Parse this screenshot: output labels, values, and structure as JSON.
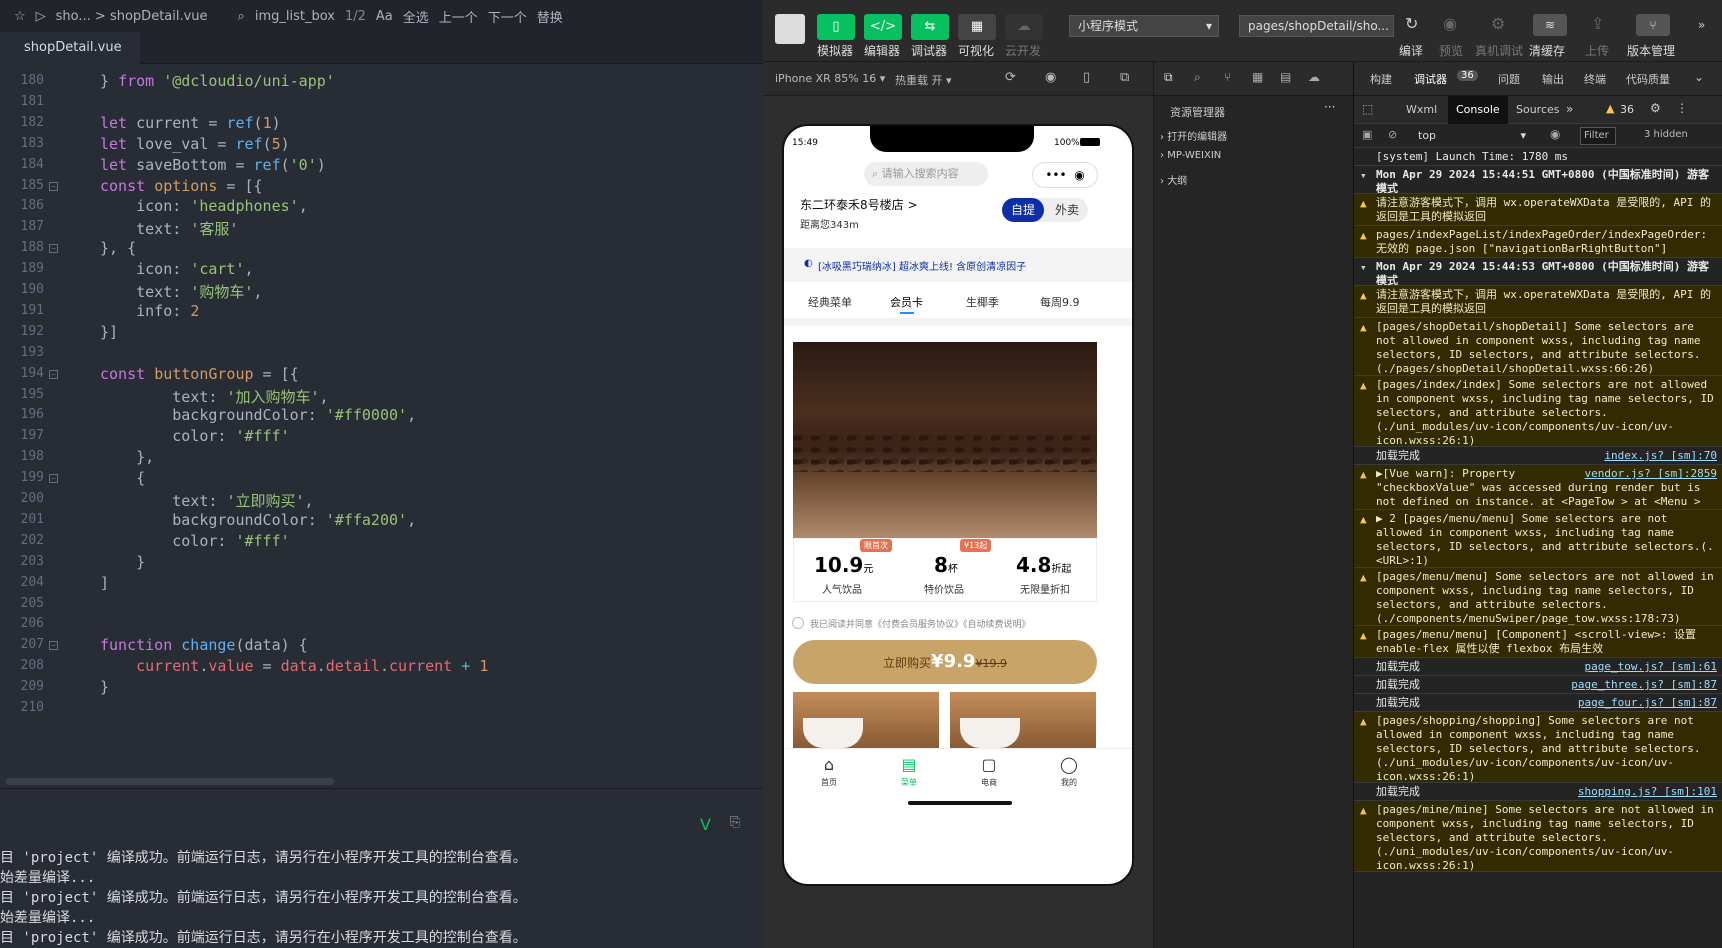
{
  "editor": {
    "top_items": [
      "sho...",
      "shopDetail.vue",
      "img_list_box",
      "1/2",
      "Aa",
      "全选",
      "上一个",
      "下一个",
      "替换"
    ],
    "tab": "shopDetail.vue",
    "lines": [
      {
        "n": "180",
        "html": "} <span class=\"kw\">from</span> <span class=\"str\">'@dcloudio/uni-app'</span>"
      },
      {
        "n": "181",
        "html": ""
      },
      {
        "n": "182",
        "html": "<span class=\"kw\">let</span> current = <span class=\"fn\">ref</span>(<span class=\"num\">1</span>)"
      },
      {
        "n": "183",
        "html": "<span class=\"kw\">let</span> love_val = <span class=\"fn\">ref</span>(<span class=\"num\">5</span>)"
      },
      {
        "n": "184",
        "html": "<span class=\"kw\">let</span> saveBottom = <span class=\"fn\">ref</span>(<span class=\"str\">'0'</span>)"
      },
      {
        "n": "185",
        "html": "<span class=\"kw\">const</span> <span class=\"num\">options</span> = [{",
        "fold": true
      },
      {
        "n": "186",
        "html": "    icon: <span class=\"str\">'headphones'</span>,"
      },
      {
        "n": "187",
        "html": "    text: <span class=\"str\">'客服'</span>"
      },
      {
        "n": "188",
        "html": "}, {",
        "fold": true
      },
      {
        "n": "189",
        "html": "    icon: <span class=\"str\">'cart'</span>,"
      },
      {
        "n": "190",
        "html": "    text: <span class=\"str\">'购物车'</span>,"
      },
      {
        "n": "191",
        "html": "    info: <span class=\"num\">2</span>"
      },
      {
        "n": "192",
        "html": "}]"
      },
      {
        "n": "193",
        "html": ""
      },
      {
        "n": "194",
        "html": "<span class=\"kw\">const</span> <span class=\"num\">buttonGroup</span> = [{",
        "fold": true
      },
      {
        "n": "195",
        "html": "        text: <span class=\"str\">'加入购物车'</span>,"
      },
      {
        "n": "196",
        "html": "        backgroundColor: <span class=\"str\">'#ff0000'</span>,"
      },
      {
        "n": "197",
        "html": "        color: <span class=\"str\">'#fff'</span>"
      },
      {
        "n": "198",
        "html": "    },"
      },
      {
        "n": "199",
        "html": "    {",
        "fold": true
      },
      {
        "n": "200",
        "html": "        text: <span class=\"str\">'立即购买'</span>,"
      },
      {
        "n": "201",
        "html": "        backgroundColor: <span class=\"str\">'#ffa200'</span>,"
      },
      {
        "n": "202",
        "html": "        color: <span class=\"str\">'#fff'</span>"
      },
      {
        "n": "203",
        "html": "    }"
      },
      {
        "n": "204",
        "html": "]"
      },
      {
        "n": "205",
        "html": ""
      },
      {
        "n": "206",
        "html": ""
      },
      {
        "n": "207",
        "html": "<span class=\"kw\">function</span> <span class=\"fn\">change</span>(data) {",
        "fold": true
      },
      {
        "n": "208",
        "html": "    <span class=\"var\">current</span>.<span class=\"var\">value</span> = <span class=\"var\">data</span>.<span class=\"var\">detail</span>.<span class=\"var\">current</span> <span class=\"op\">+</span> <span class=\"num\">1</span>"
      },
      {
        "n": "209",
        "html": "}"
      },
      {
        "n": "210",
        "html": ""
      }
    ],
    "console_lines": [
      "目 'project' 编译成功。前端运行日志，请另行在小程序开发工具的控制台查看。",
      "始差量编译...",
      "目 'project' 编译成功。前端运行日志，请另行在小程序开发工具的控制台查看。",
      "始差量编译...",
      "目 'project' 编译成功。前端运行日志，请另行在小程序开发工具的控制台查看。"
    ]
  },
  "toolbar": {
    "buttons": [
      "模拟器",
      "编辑器",
      "调试器",
      "可视化",
      "云开发"
    ],
    "mode_select": "小程序模式",
    "path_select": "pages/shopDetail/sho...",
    "right_buttons": [
      "编译",
      "预览",
      "真机调试",
      "清缓存",
      "上传",
      "版本管理"
    ]
  },
  "sim": {
    "device": "iPhone XR 85% 16",
    "hotreload": "热重载 开"
  },
  "phone": {
    "time": "15:49",
    "battery": "100%",
    "search_placeholder": "请输入搜索内容",
    "address": "东二环泰禾8号楼店 >",
    "distance": "距离您343m",
    "mode_self": "自提",
    "mode_takeout": "外卖",
    "notice": "[冰吸黑巧瑞纳冰] 超冰爽上线! 含原创清凉因子",
    "tabs": [
      "经典菜单",
      "会员卡",
      "生椰季",
      "每周9.9"
    ],
    "stats": [
      {
        "big": "10.9",
        "unit": "元",
        "label": "人气饮品",
        "badge": "限首次"
      },
      {
        "big": "8",
        "unit": "杯",
        "label": "特价饮品",
        "badge": "¥13起"
      },
      {
        "big": "4.8",
        "unit": "折起",
        "label": "无限量折扣",
        "badge": ""
      }
    ],
    "agree": "我已阅读并同意《付费会员服务协议》《自动续费说明》",
    "buy_label": "立即购买",
    "buy_price": "¥9.9",
    "buy_old": "¥19.9",
    "nav": [
      "首页",
      "菜单",
      "电商",
      "我的"
    ]
  },
  "explorer": {
    "title": "资源管理器",
    "items": [
      "打开的编辑器",
      "MP-WEIXIN",
      "大纲"
    ]
  },
  "devtools": {
    "top_tabs": [
      "构建",
      "调试器",
      "问题",
      "输出",
      "终端",
      "代码质量"
    ],
    "debug_count": "36",
    "panel_tabs": [
      "Wxml",
      "Console",
      "Sources"
    ],
    "warn_count": "36",
    "context": "top",
    "filter": "Filter",
    "hidden": "3 hidden",
    "logs": [
      {
        "type": "info",
        "text": "[system] Launch Time: 1780 ms",
        "src": ""
      },
      {
        "type": "group",
        "text": "Mon Apr 29 2024 15:44:51 GMT+0800 (中国标准时间) 游客模式",
        "src": ""
      },
      {
        "type": "warn",
        "text": "请注意游客模式下，调用 wx.operateWXData 是受限的, API 的返回是工具的模拟返回",
        "src": ""
      },
      {
        "type": "warn",
        "text": "pages/indexPageList/indexPageOrder/indexPageOrder: 无效的 page.json [\"navigationBarRightButton\"]",
        "src": ""
      },
      {
        "type": "group",
        "text": "Mon Apr 29 2024 15:44:53 GMT+0800 (中国标准时间) 游客模式",
        "src": ""
      },
      {
        "type": "warn",
        "text": "请注意游客模式下，调用 wx.operateWXData 是受限的, API 的返回是工具的模拟返回",
        "src": ""
      },
      {
        "type": "warn",
        "text": "[pages/shopDetail/shopDetail] Some selectors are not allowed in component wxss, including tag name selectors, ID selectors, and attribute selectors.(./pages/shopDetail/shopDetail.wxss:66:26)",
        "src": ""
      },
      {
        "type": "warn",
        "text": "[pages/index/index] Some selectors are not allowed in component wxss, including tag name selectors, ID selectors, and attribute selectors.(./uni_modules/uv-icon/components/uv-icon/uv-icon.wxss:26:1)",
        "src": ""
      },
      {
        "type": "info",
        "text": "加载完成",
        "src": "index.js? [sm]:70"
      },
      {
        "type": "warn",
        "text": "▶[Vue warn]: Property \"checkboxValue\" was accessed during render but is not defined on instance. at <PageTow > at <Menu >",
        "src": "vendor.js? [sm]:2859"
      },
      {
        "type": "warn",
        "text": "▶ 2 [pages/menu/menu] Some selectors are not allowed in component wxss, including tag name selectors, ID selectors, and attribute selectors.(.<URL>:1)",
        "src": ""
      },
      {
        "type": "warn",
        "text": "[pages/menu/menu] Some selectors are not allowed in component wxss, including tag name selectors, ID selectors, and attribute selectors.(./components/menuSwiper/page_tow.wxss:178:73)",
        "src": ""
      },
      {
        "type": "warn",
        "text": "[pages/menu/menu] [Component] <scroll-view>: 设置 enable-flex 属性以使 flexbox 布局生效",
        "src": ""
      },
      {
        "type": "info",
        "text": "加载完成",
        "src": "page_tow.js? [sm]:61"
      },
      {
        "type": "info",
        "text": "加载完成",
        "src": "page_three.js? [sm]:87"
      },
      {
        "type": "info",
        "text": "加载完成",
        "src": "page_four.js? [sm]:87"
      },
      {
        "type": "warn",
        "text": "[pages/shopping/shopping] Some selectors are not allowed in component wxss, including tag name selectors, ID selectors, and attribute selectors.(./uni_modules/uv-icon/components/uv-icon/uv-icon.wxss:26:1)",
        "src": ""
      },
      {
        "type": "info",
        "text": "加载完成",
        "src": "shopping.js? [sm]:101"
      },
      {
        "type": "warn",
        "text": "[pages/mine/mine] Some selectors are not allowed in component wxss, including tag name selectors, ID selectors, and attribute selectors.(./uni_modules/uv-icon/components/uv-icon/uv-icon.wxss:26:1)",
        "src": ""
      }
    ]
  },
  "colors": {
    "accent": "#07c160",
    "brand": "#c9a468",
    "self_btn": "#0d2ea7"
  }
}
